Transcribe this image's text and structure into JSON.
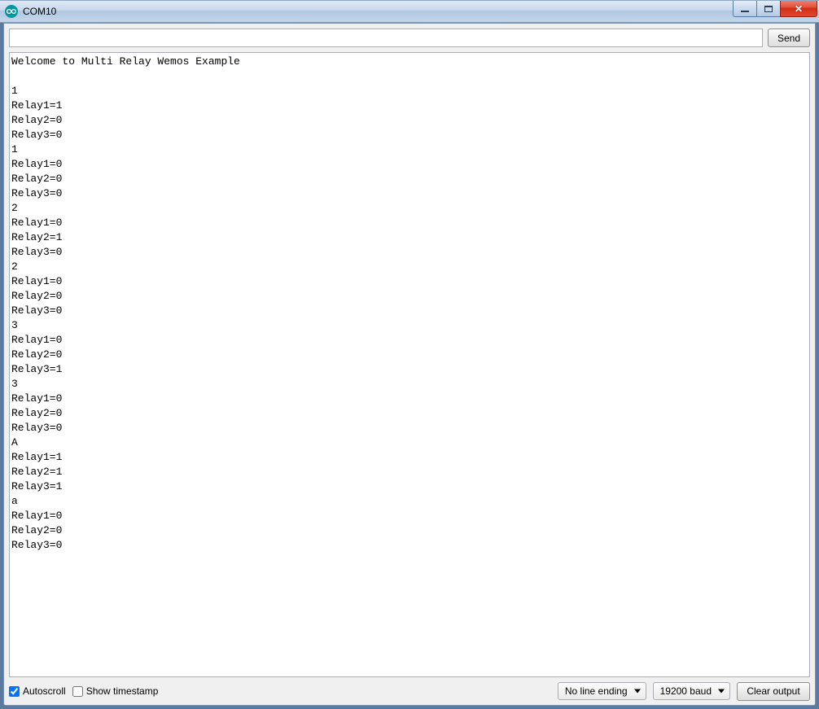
{
  "window": {
    "title": "COM10"
  },
  "toolbar": {
    "send_label": "Send",
    "input_value": ""
  },
  "output": {
    "text": "Welcome to Multi Relay Wemos Example\n\n1\nRelay1=1\nRelay2=0\nRelay3=0\n1\nRelay1=0\nRelay2=0\nRelay3=0\n2\nRelay1=0\nRelay2=1\nRelay3=0\n2\nRelay1=0\nRelay2=0\nRelay3=0\n3\nRelay1=0\nRelay2=0\nRelay3=1\n3\nRelay1=0\nRelay2=0\nRelay3=0\nA\nRelay1=1\nRelay2=1\nRelay3=1\na\nRelay1=0\nRelay2=0\nRelay3=0"
  },
  "footer": {
    "autoscroll_label": "Autoscroll",
    "autoscroll_checked": true,
    "timestamp_label": "Show timestamp",
    "timestamp_checked": false,
    "line_ending_selected": "No line ending",
    "baud_selected": "19200 baud",
    "clear_label": "Clear output"
  }
}
